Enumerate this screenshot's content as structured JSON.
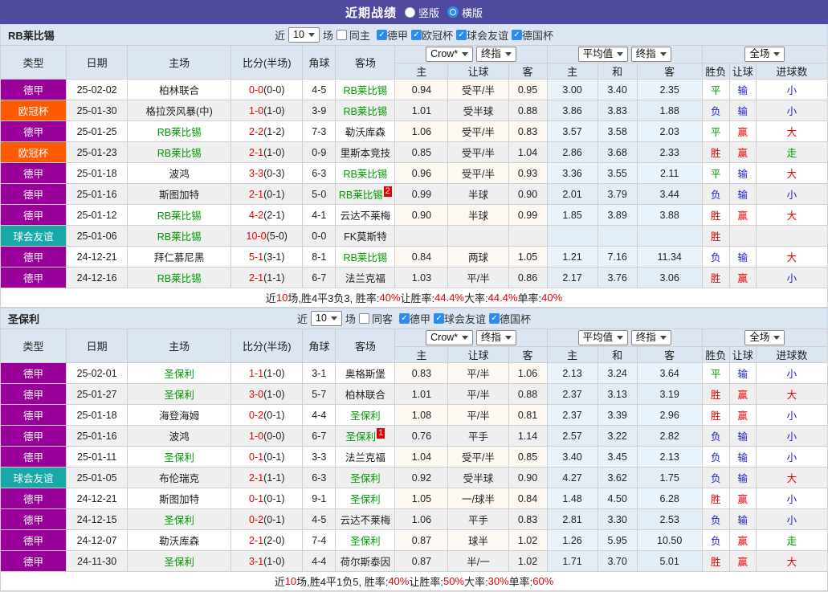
{
  "title_bar": {
    "title": "近期战绩",
    "radios": [
      {
        "label": "竖版",
        "selected": false
      },
      {
        "label": "横版",
        "selected": true
      }
    ]
  },
  "colors": {
    "title_bar_bg": "#4f4a9d",
    "header_bg": "#dce6f2",
    "checkbox_blue": "#2b8ced",
    "highlight_team": "#009900",
    "score_red": "#e60000",
    "league": {
      "德甲": "#990099",
      "欧冠杯": "#ff5a00",
      "球会友谊": "#18a8a8"
    },
    "mark": {
      "胜": "#e60000",
      "平": "#009900",
      "负": "#2323cc",
      "赢": "#e60000",
      "输": "#2323cc",
      "大": "#e60000",
      "小": "#2323cc",
      "走": "#009900"
    }
  },
  "table_headers": {
    "base": [
      "类型",
      "日期",
      "主场",
      "比分(半场)",
      "角球",
      "客场"
    ],
    "group1_selects": [
      "Crow*",
      "终指"
    ],
    "group1_cols": [
      "主",
      "让球",
      "客"
    ],
    "group2_selects": [
      "平均值",
      "终指"
    ],
    "group2_cols": [
      "主",
      "和",
      "客"
    ],
    "group3_select": "全场",
    "group3_cols": [
      "胜负",
      "让球",
      "进球数"
    ]
  },
  "sections": [
    {
      "team": "RB莱比锡",
      "filter": {
        "prefix": "近",
        "count": "10",
        "suffix": "场",
        "venue_label": "同主",
        "venue_checked": false,
        "leagues": [
          {
            "label": "德甲",
            "checked": true
          },
          {
            "label": "欧冠杯",
            "checked": true
          },
          {
            "label": "球会友谊",
            "checked": true
          },
          {
            "label": "德国杯",
            "checked": true
          }
        ]
      },
      "rows": [
        {
          "league": "德甲",
          "date": "25-02-02",
          "home": "柏林联合",
          "home_hl": false,
          "score": "0-0",
          "half": "(0-0)",
          "corner": "4-5",
          "away": "RB莱比锡",
          "away_hl": true,
          "away_badge": "",
          "crow_home": "0.94",
          "handicap": "受平/半",
          "crow_away": "0.95",
          "avg_home": "3.00",
          "avg_draw": "3.40",
          "avg_away": "2.35",
          "result": "平",
          "handicap_result": "输",
          "goals_result": "小"
        },
        {
          "league": "欧冠杯",
          "date": "25-01-30",
          "home": "格拉茨风暴(中)",
          "home_hl": false,
          "score": "1-0",
          "half": "(1-0)",
          "corner": "3-9",
          "away": "RB莱比锡",
          "away_hl": true,
          "away_badge": "",
          "crow_home": "1.01",
          "handicap": "受半球",
          "crow_away": "0.88",
          "avg_home": "3.86",
          "avg_draw": "3.83",
          "avg_away": "1.88",
          "result": "负",
          "handicap_result": "输",
          "goals_result": "小"
        },
        {
          "league": "德甲",
          "date": "25-01-25",
          "home": "RB莱比锡",
          "home_hl": true,
          "score": "2-2",
          "half": "(1-2)",
          "corner": "7-3",
          "away": "勒沃库森",
          "away_hl": false,
          "away_badge": "",
          "crow_home": "1.06",
          "handicap": "受平/半",
          "crow_away": "0.83",
          "avg_home": "3.57",
          "avg_draw": "3.58",
          "avg_away": "2.03",
          "result": "平",
          "handicap_result": "赢",
          "goals_result": "大"
        },
        {
          "league": "欧冠杯",
          "date": "25-01-23",
          "home": "RB莱比锡",
          "home_hl": true,
          "score": "2-1",
          "half": "(1-0)",
          "corner": "0-9",
          "away": "里斯本竞技",
          "away_hl": false,
          "away_badge": "",
          "crow_home": "0.85",
          "handicap": "受平/半",
          "crow_away": "1.04",
          "avg_home": "2.86",
          "avg_draw": "3.68",
          "avg_away": "2.33",
          "result": "胜",
          "handicap_result": "赢",
          "goals_result": "走"
        },
        {
          "league": "德甲",
          "date": "25-01-18",
          "home": "波鸿",
          "home_hl": false,
          "score": "3-3",
          "half": "(0-3)",
          "corner": "6-3",
          "away": "RB莱比锡",
          "away_hl": true,
          "away_badge": "",
          "crow_home": "0.96",
          "handicap": "受平/半",
          "crow_away": "0.93",
          "avg_home": "3.36",
          "avg_draw": "3.55",
          "avg_away": "2.11",
          "result": "平",
          "handicap_result": "输",
          "goals_result": "大"
        },
        {
          "league": "德甲",
          "date": "25-01-16",
          "home": "斯图加特",
          "home_hl": false,
          "score": "2-1",
          "half": "(0-1)",
          "corner": "5-0",
          "away": "RB莱比锡",
          "away_hl": true,
          "away_badge": "2",
          "crow_home": "0.99",
          "handicap": "半球",
          "crow_away": "0.90",
          "avg_home": "2.01",
          "avg_draw": "3.79",
          "avg_away": "3.44",
          "result": "负",
          "handicap_result": "输",
          "goals_result": "小"
        },
        {
          "league": "德甲",
          "date": "25-01-12",
          "home": "RB莱比锡",
          "home_hl": true,
          "score": "4-2",
          "half": "(2-1)",
          "corner": "4-1",
          "away": "云达不莱梅",
          "away_hl": false,
          "away_badge": "",
          "crow_home": "0.90",
          "handicap": "半球",
          "crow_away": "0.99",
          "avg_home": "1.85",
          "avg_draw": "3.89",
          "avg_away": "3.88",
          "result": "胜",
          "handicap_result": "赢",
          "goals_result": "大"
        },
        {
          "league": "球会友谊",
          "date": "25-01-06",
          "home": "RB莱比锡",
          "home_hl": true,
          "score": "10-0",
          "half": "(5-0)",
          "corner": "0-0",
          "away": "FK莫斯特",
          "away_hl": false,
          "away_badge": "",
          "crow_home": "",
          "handicap": "",
          "crow_away": "",
          "avg_home": "",
          "avg_draw": "",
          "avg_away": "",
          "result": "胜",
          "handicap_result": "",
          "goals_result": ""
        },
        {
          "league": "德甲",
          "date": "24-12-21",
          "home": "拜仁慕尼黑",
          "home_hl": false,
          "score": "5-1",
          "half": "(3-1)",
          "corner": "8-1",
          "away": "RB莱比锡",
          "away_hl": true,
          "away_badge": "",
          "crow_home": "0.84",
          "handicap": "两球",
          "crow_away": "1.05",
          "avg_home": "1.21",
          "avg_draw": "7.16",
          "avg_away": "11.34",
          "result": "负",
          "handicap_result": "输",
          "goals_result": "大"
        },
        {
          "league": "德甲",
          "date": "24-12-16",
          "home": "RB莱比锡",
          "home_hl": true,
          "score": "2-1",
          "half": "(1-1)",
          "corner": "6-7",
          "away": "法兰克福",
          "away_hl": false,
          "away_badge": "",
          "crow_home": "1.03",
          "handicap": "平/半",
          "crow_away": "0.86",
          "avg_home": "2.17",
          "avg_draw": "3.76",
          "avg_away": "3.06",
          "result": "胜",
          "handicap_result": "赢",
          "goals_result": "小"
        }
      ],
      "summary": [
        {
          "text": "近",
          "red": false
        },
        {
          "text": "10",
          "red": true
        },
        {
          "text": "场,胜4平3负3, 胜率:",
          "red": false
        },
        {
          "text": "40%",
          "red": true
        },
        {
          "text": " 让胜率:",
          "red": false
        },
        {
          "text": "44.4%",
          "red": true
        },
        {
          "text": " 大率:",
          "red": false
        },
        {
          "text": "44.4%",
          "red": true
        },
        {
          "text": " 单率:",
          "red": false
        },
        {
          "text": "40%",
          "red": true
        }
      ]
    },
    {
      "team": "圣保利",
      "filter": {
        "prefix": "近",
        "count": "10",
        "suffix": "场",
        "venue_label": "同客",
        "venue_checked": false,
        "leagues": [
          {
            "label": "德甲",
            "checked": true
          },
          {
            "label": "球会友谊",
            "checked": true
          },
          {
            "label": "德国杯",
            "checked": true
          }
        ]
      },
      "rows": [
        {
          "league": "德甲",
          "date": "25-02-01",
          "home": "圣保利",
          "home_hl": true,
          "score": "1-1",
          "half": "(1-0)",
          "corner": "3-1",
          "away": "奥格斯堡",
          "away_hl": false,
          "away_badge": "",
          "crow_home": "0.83",
          "handicap": "平/半",
          "crow_away": "1.06",
          "avg_home": "2.13",
          "avg_draw": "3.24",
          "avg_away": "3.64",
          "result": "平",
          "handicap_result": "输",
          "goals_result": "小"
        },
        {
          "league": "德甲",
          "date": "25-01-27",
          "home": "圣保利",
          "home_hl": true,
          "score": "3-0",
          "half": "(1-0)",
          "corner": "5-7",
          "away": "柏林联合",
          "away_hl": false,
          "away_badge": "",
          "crow_home": "1.01",
          "handicap": "平/半",
          "crow_away": "0.88",
          "avg_home": "2.37",
          "avg_draw": "3.13",
          "avg_away": "3.19",
          "result": "胜",
          "handicap_result": "赢",
          "goals_result": "大"
        },
        {
          "league": "德甲",
          "date": "25-01-18",
          "home": "海登海姆",
          "home_hl": false,
          "score": "0-2",
          "half": "(0-1)",
          "corner": "4-4",
          "away": "圣保利",
          "away_hl": true,
          "away_badge": "",
          "crow_home": "1.08",
          "handicap": "平/半",
          "crow_away": "0.81",
          "avg_home": "2.37",
          "avg_draw": "3.39",
          "avg_away": "2.96",
          "result": "胜",
          "handicap_result": "赢",
          "goals_result": "小"
        },
        {
          "league": "德甲",
          "date": "25-01-16",
          "home": "波鸿",
          "home_hl": false,
          "score": "1-0",
          "half": "(0-0)",
          "corner": "6-7",
          "away": "圣保利",
          "away_hl": true,
          "away_badge": "1",
          "crow_home": "0.76",
          "handicap": "平手",
          "crow_away": "1.14",
          "avg_home": "2.57",
          "avg_draw": "3.22",
          "avg_away": "2.82",
          "result": "负",
          "handicap_result": "输",
          "goals_result": "小"
        },
        {
          "league": "德甲",
          "date": "25-01-11",
          "home": "圣保利",
          "home_hl": true,
          "score": "0-1",
          "half": "(0-1)",
          "corner": "3-3",
          "away": "法兰克福",
          "away_hl": false,
          "away_badge": "",
          "crow_home": "1.04",
          "handicap": "受平/半",
          "crow_away": "0.85",
          "avg_home": "3.40",
          "avg_draw": "3.45",
          "avg_away": "2.13",
          "result": "负",
          "handicap_result": "输",
          "goals_result": "小"
        },
        {
          "league": "球会友谊",
          "date": "25-01-05",
          "home": "布伦瑞克",
          "home_hl": false,
          "score": "2-1",
          "half": "(1-1)",
          "corner": "6-3",
          "away": "圣保利",
          "away_hl": true,
          "away_badge": "",
          "crow_home": "0.92",
          "handicap": "受半球",
          "crow_away": "0.90",
          "avg_home": "4.27",
          "avg_draw": "3.62",
          "avg_away": "1.75",
          "result": "负",
          "handicap_result": "输",
          "goals_result": "大"
        },
        {
          "league": "德甲",
          "date": "24-12-21",
          "home": "斯图加特",
          "home_hl": false,
          "score": "0-1",
          "half": "(0-1)",
          "corner": "9-1",
          "away": "圣保利",
          "away_hl": true,
          "away_badge": "",
          "crow_home": "1.05",
          "handicap": "一/球半",
          "crow_away": "0.84",
          "avg_home": "1.48",
          "avg_draw": "4.50",
          "avg_away": "6.28",
          "result": "胜",
          "handicap_result": "赢",
          "goals_result": "小"
        },
        {
          "league": "德甲",
          "date": "24-12-15",
          "home": "圣保利",
          "home_hl": true,
          "score": "0-2",
          "half": "(0-1)",
          "corner": "4-5",
          "away": "云达不莱梅",
          "away_hl": false,
          "away_badge": "",
          "crow_home": "1.06",
          "handicap": "平手",
          "crow_away": "0.83",
          "avg_home": "2.81",
          "avg_draw": "3.30",
          "avg_away": "2.53",
          "result": "负",
          "handicap_result": "输",
          "goals_result": "小"
        },
        {
          "league": "德甲",
          "date": "24-12-07",
          "home": "勒沃库森",
          "home_hl": false,
          "score": "2-1",
          "half": "(2-0)",
          "corner": "7-4",
          "away": "圣保利",
          "away_hl": true,
          "away_badge": "",
          "crow_home": "0.87",
          "handicap": "球半",
          "crow_away": "1.02",
          "avg_home": "1.26",
          "avg_draw": "5.95",
          "avg_away": "10.50",
          "result": "负",
          "handicap_result": "赢",
          "goals_result": "走"
        },
        {
          "league": "德甲",
          "date": "24-11-30",
          "home": "圣保利",
          "home_hl": true,
          "score": "3-1",
          "half": "(1-0)",
          "corner": "4-4",
          "away": "荷尔斯泰因",
          "away_hl": false,
          "away_badge": "",
          "crow_home": "0.87",
          "handicap": "半/一",
          "crow_away": "1.02",
          "avg_home": "1.71",
          "avg_draw": "3.70",
          "avg_away": "5.01",
          "result": "胜",
          "handicap_result": "赢",
          "goals_result": "大"
        }
      ],
      "summary": [
        {
          "text": "近",
          "red": false
        },
        {
          "text": "10",
          "red": true
        },
        {
          "text": "场,胜4平1负5, 胜率:",
          "red": false
        },
        {
          "text": "40%",
          "red": true
        },
        {
          "text": " 让胜率:",
          "red": false
        },
        {
          "text": "50%",
          "red": true
        },
        {
          "text": " 大率:",
          "red": false
        },
        {
          "text": "30%",
          "red": true
        },
        {
          "text": " 单率:",
          "red": false
        },
        {
          "text": "60%",
          "red": true
        }
      ]
    }
  ]
}
